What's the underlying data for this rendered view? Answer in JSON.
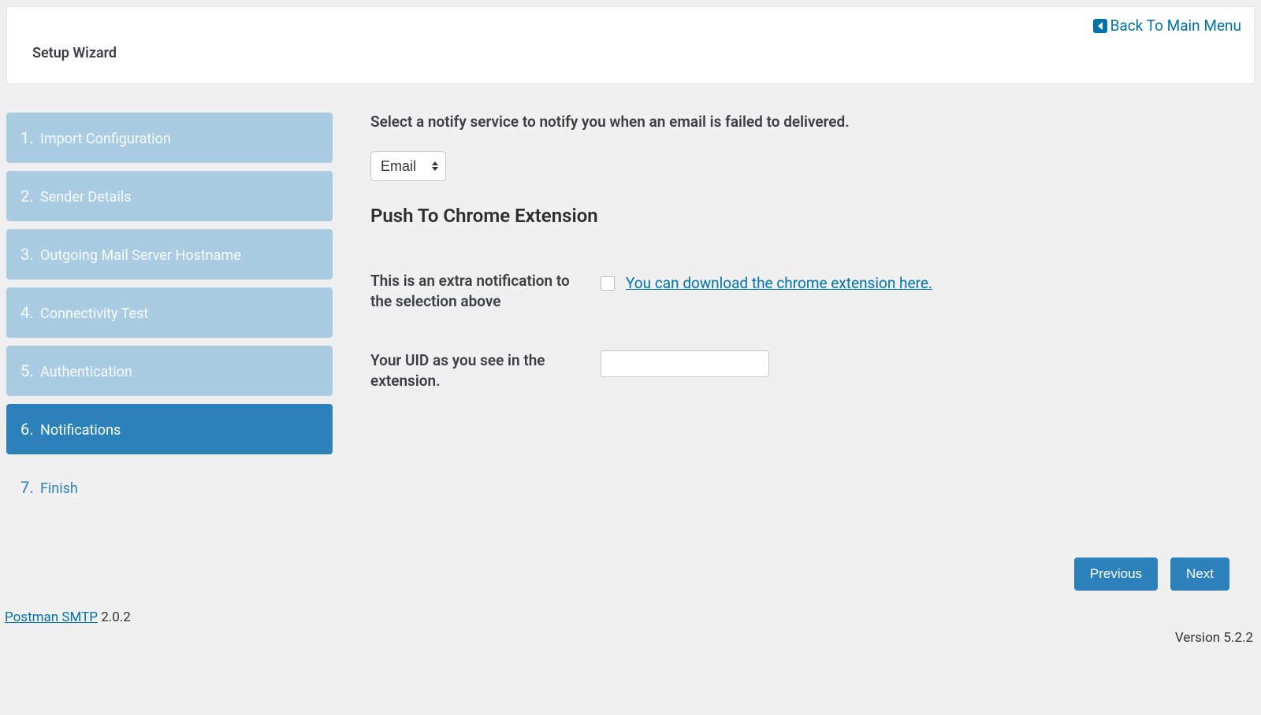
{
  "header": {
    "title": "Setup Wizard",
    "back_label": "Back To Main Menu"
  },
  "sidebar": {
    "steps": [
      {
        "num": "1.",
        "label": "Import Configuration",
        "state": "done"
      },
      {
        "num": "2.",
        "label": "Sender Details",
        "state": "done"
      },
      {
        "num": "3.",
        "label": "Outgoing Mail Server Hostname",
        "state": "done"
      },
      {
        "num": "4.",
        "label": "Connectivity Test",
        "state": "done"
      },
      {
        "num": "5.",
        "label": "Authentication",
        "state": "done"
      },
      {
        "num": "6.",
        "label": "Notifications",
        "state": "active"
      },
      {
        "num": "7.",
        "label": "Finish",
        "state": "pending"
      }
    ]
  },
  "main": {
    "description": "Select a notify service to notify you when an email is failed to delivered.",
    "notify_selected": "Email",
    "section_heading": "Push To Chrome Extension",
    "extra_label": "This is an extra notification to the selection above",
    "download_link_text": "You can download the chrome extension here.",
    "uid_label": "Your UID as you see in the extension.",
    "uid_value": ""
  },
  "buttons": {
    "previous": "Previous",
    "next": "Next"
  },
  "footer": {
    "product_link": "Postman SMTP",
    "product_version": "2.0.2",
    "platform_version": "Version 5.2.2"
  }
}
